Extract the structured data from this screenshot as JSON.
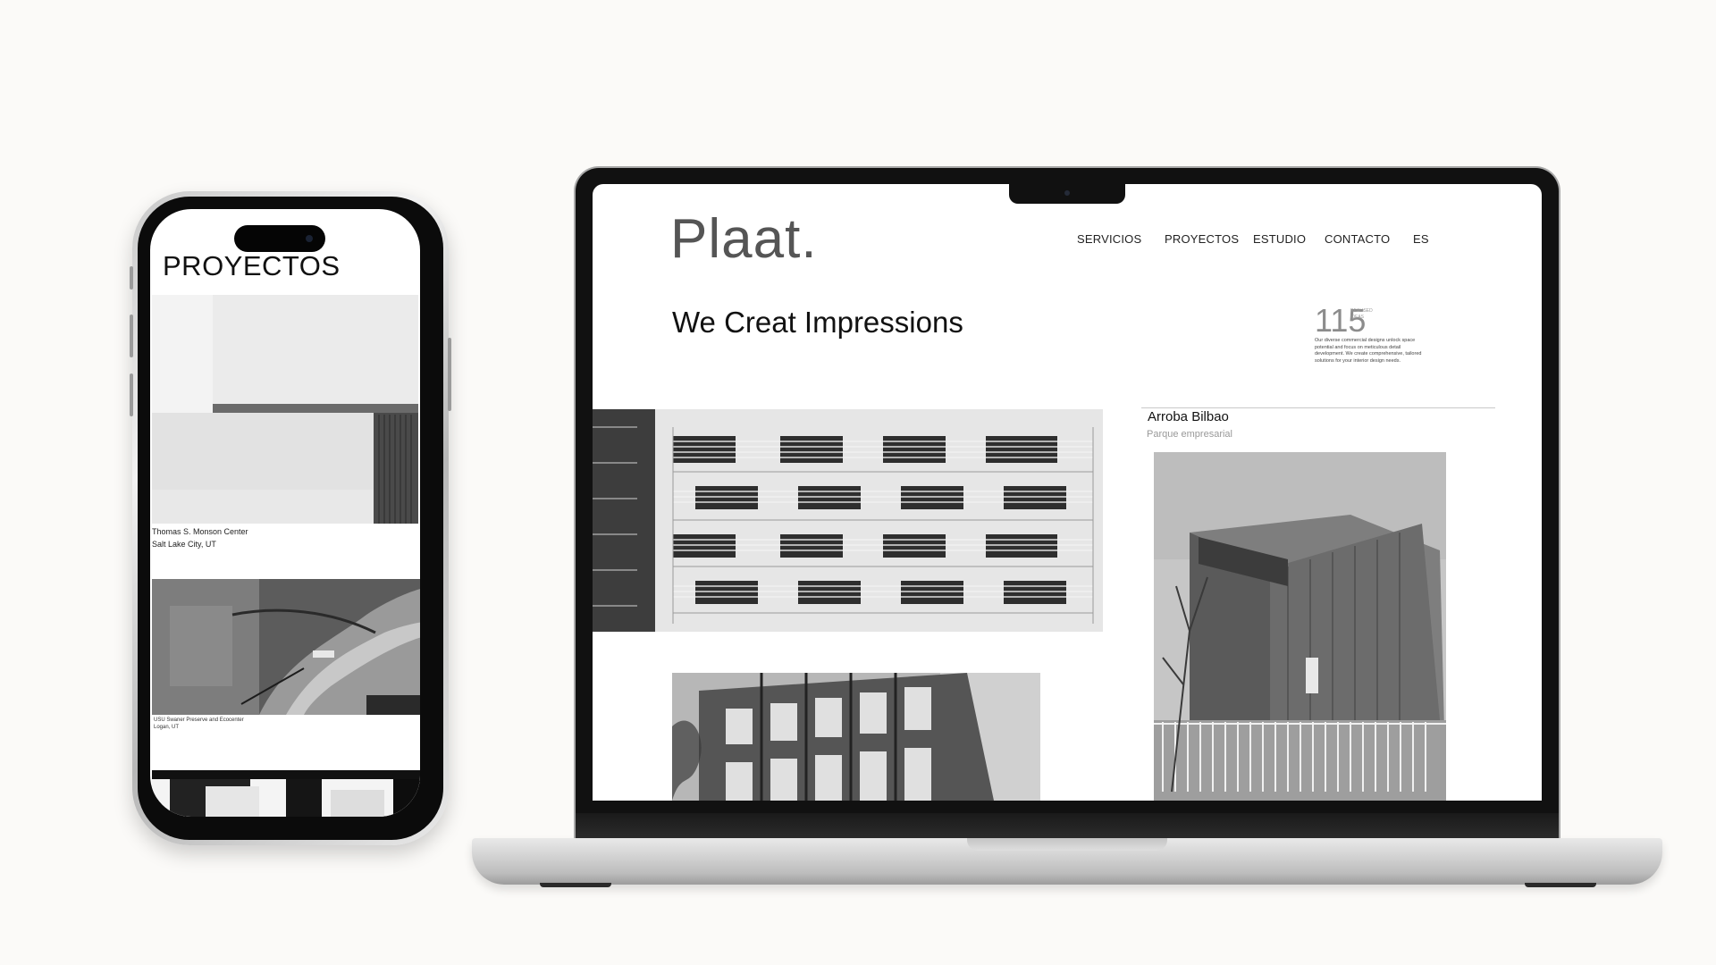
{
  "mobile": {
    "title": "PROYECTOS",
    "projects": [
      {
        "name": "Thomas S. Monson Center",
        "location": "Salt Lake City, UT"
      },
      {
        "name": "USU Swaner Preserve and Ecocenter",
        "location": "Logan, UT"
      }
    ]
  },
  "desktop": {
    "logo": "Plaat.",
    "nav": [
      "SERVICIOS",
      "PROYECTOS",
      "ESTUDIO",
      "CONTACTO",
      "ES"
    ],
    "hero": "We Creat Impressions",
    "stat": {
      "number": "115",
      "label": "REALISED IDEAS",
      "description": "Our diverse commercial designs unlock space potential and focus on meticulous detail development. We create comprehensive, tailored solutions for your interior design needs."
    },
    "featured": {
      "title": "Arroba Bilbao",
      "subtitle": "Parque empresarial"
    }
  },
  "colors": {
    "background": "#fbfaf8",
    "text": "#111111",
    "muted": "#999999"
  }
}
